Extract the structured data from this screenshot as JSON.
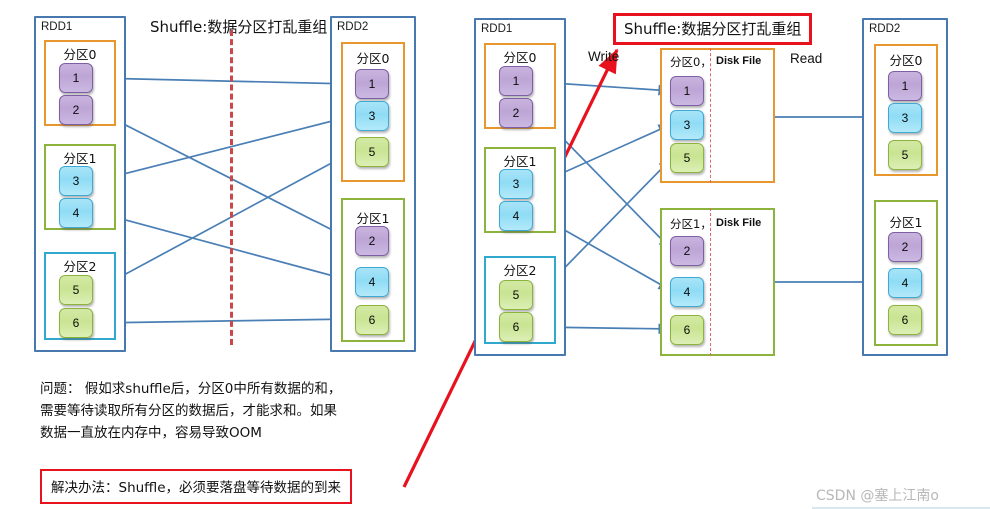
{
  "left_diagram": {
    "title": "Shuffle:数据分区打乱重组",
    "source_rdd": {
      "label": "RDD1",
      "partitions": [
        {
          "title": "分区0",
          "color": "orange",
          "cells": [
            {
              "value": "1",
              "color": "purple"
            },
            {
              "value": "2",
              "color": "purple"
            }
          ]
        },
        {
          "title": "分区1",
          "color": "green",
          "cells": [
            {
              "value": "3",
              "color": "blue"
            },
            {
              "value": "4",
              "color": "blue"
            }
          ]
        },
        {
          "title": "分区2",
          "color": "cyan",
          "cells": [
            {
              "value": "5",
              "color": "green"
            },
            {
              "value": "6",
              "color": "green"
            }
          ]
        }
      ]
    },
    "target_rdd": {
      "label": "RDD2",
      "partitions": [
        {
          "title": "分区0",
          "color": "orange",
          "cells": [
            {
              "value": "1",
              "color": "purple"
            },
            {
              "value": "3",
              "color": "blue"
            },
            {
              "value": "5",
              "color": "green"
            }
          ]
        },
        {
          "title": "分区1",
          "color": "green",
          "cells": [
            {
              "value": "2",
              "color": "purple"
            },
            {
              "value": "4",
              "color": "blue"
            },
            {
              "value": "6",
              "color": "green"
            }
          ]
        }
      ]
    }
  },
  "right_diagram": {
    "title": "Shuffle:数据分区打乱重组",
    "write_label": "Write",
    "read_label": "Read",
    "source_rdd": {
      "label": "RDD1",
      "partitions": [
        {
          "title": "分区0",
          "color": "orange",
          "cells": [
            {
              "value": "1",
              "color": "purple"
            },
            {
              "value": "2",
              "color": "purple"
            }
          ]
        },
        {
          "title": "分区1",
          "color": "green",
          "cells": [
            {
              "value": "3",
              "color": "blue"
            },
            {
              "value": "4",
              "color": "blue"
            }
          ]
        },
        {
          "title": "分区2",
          "color": "cyan",
          "cells": [
            {
              "value": "5",
              "color": "green"
            },
            {
              "value": "6",
              "color": "green"
            }
          ]
        }
      ]
    },
    "disk_files": [
      {
        "title": "分区0，",
        "file_label": "Disk File",
        "color": "orange",
        "cells": [
          {
            "value": "1",
            "color": "purple"
          },
          {
            "value": "3",
            "color": "blue"
          },
          {
            "value": "5",
            "color": "green"
          }
        ]
      },
      {
        "title": "分区1，",
        "file_label": "Disk File",
        "color": "green",
        "cells": [
          {
            "value": "2",
            "color": "purple"
          },
          {
            "value": "4",
            "color": "blue"
          },
          {
            "value": "6",
            "color": "green"
          }
        ]
      }
    ],
    "target_rdd": {
      "label": "RDD2",
      "partitions": [
        {
          "title": "分区0",
          "color": "orange",
          "cells": [
            {
              "value": "1",
              "color": "purple"
            },
            {
              "value": "3",
              "color": "blue"
            },
            {
              "value": "5",
              "color": "green"
            }
          ]
        },
        {
          "title": "分区1",
          "color": "green",
          "cells": [
            {
              "value": "2",
              "color": "purple"
            },
            {
              "value": "4",
              "color": "blue"
            },
            {
              "value": "6",
              "color": "green"
            }
          ]
        }
      ]
    }
  },
  "notes": {
    "problem": "问题： 假如求shuffle后，分区0中所有数据的和，\n需要等待读取所有分区的数据后，才能求和。如果\n数据一直放在内存中，容易导致OOM",
    "solution": "解决办法：Shuffle，必须要落盘等待数据的到来"
  },
  "watermark": "CSDN @塞上江南o",
  "colors": {
    "rdd_border": "#4878b0",
    "partition_orange": "#e8962e",
    "partition_green": "#8cb43c",
    "partition_cyan": "#31a8cd",
    "arrow_blue": "#4a7fb5",
    "highlight_red": "#e8121e",
    "dashed_red": "#c9484b"
  }
}
